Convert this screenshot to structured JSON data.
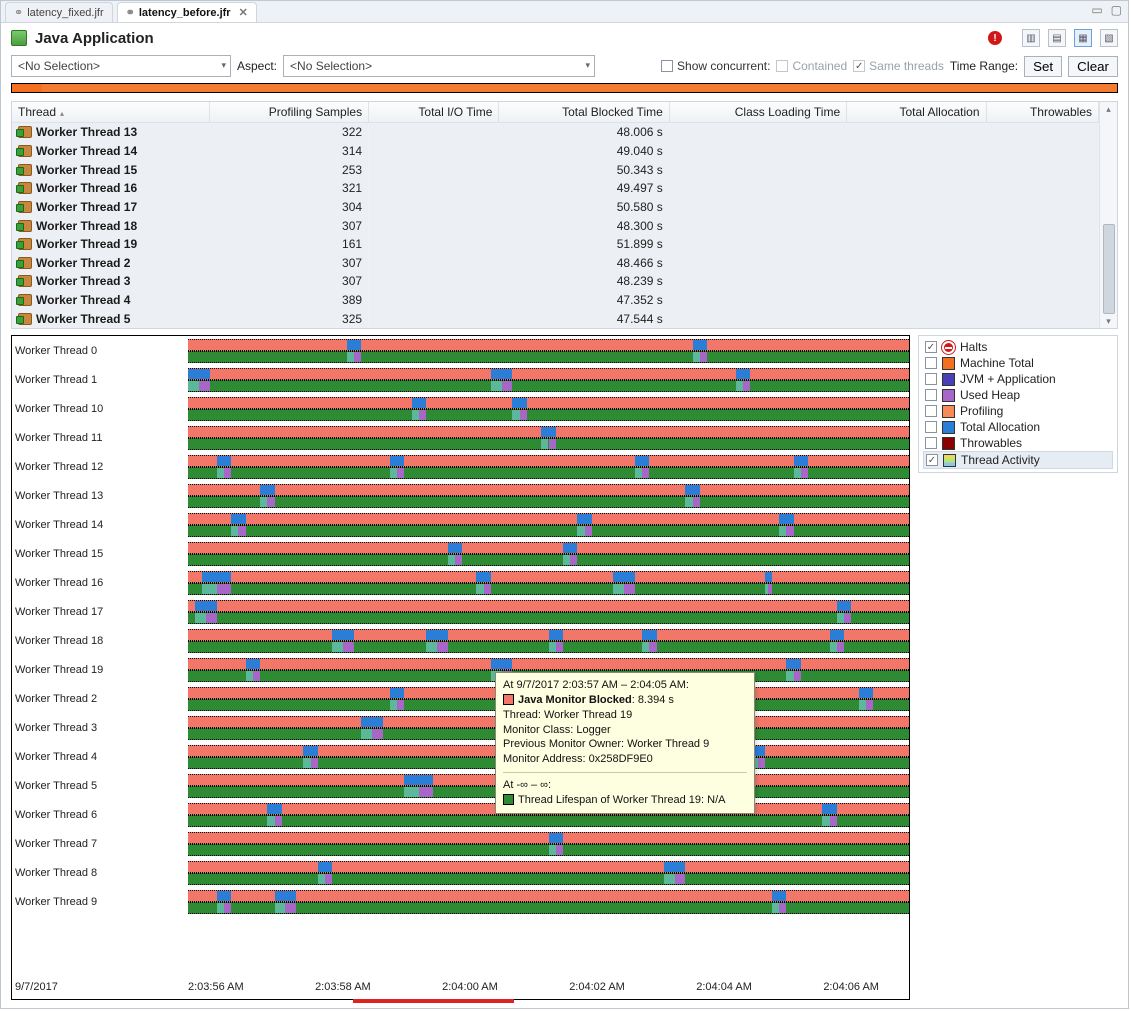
{
  "tabs": [
    {
      "label": "latency_fixed.jfr",
      "active": false
    },
    {
      "label": "latency_before.jfr",
      "active": true
    }
  ],
  "title": "Java Application",
  "header_icons": [
    "alert",
    "layout-1",
    "layout-2",
    "layout-3",
    "layout-4"
  ],
  "filters": {
    "thread_selection": "<No Selection>",
    "aspect_label": "Aspect:",
    "aspect_selection": "<No Selection>",
    "show_concurrent": "Show concurrent:",
    "contained": "Contained",
    "same_threads": "Same threads",
    "time_range_label": "Time Range:",
    "set": "Set",
    "clear": "Clear"
  },
  "columns": [
    "Thread",
    "Profiling Samples",
    "Total I/O Time",
    "Total Blocked Time",
    "Class Loading Time",
    "Total Allocation",
    "Throwables"
  ],
  "rows": [
    {
      "name": "Worker Thread 13",
      "samples": "322",
      "blocked": "48.006 s"
    },
    {
      "name": "Worker Thread 14",
      "samples": "314",
      "blocked": "49.040 s"
    },
    {
      "name": "Worker Thread 15",
      "samples": "253",
      "blocked": "50.343 s"
    },
    {
      "name": "Worker Thread 16",
      "samples": "321",
      "blocked": "49.497 s"
    },
    {
      "name": "Worker Thread 17",
      "samples": "304",
      "blocked": "50.580 s"
    },
    {
      "name": "Worker Thread 18",
      "samples": "307",
      "blocked": "48.300 s"
    },
    {
      "name": "Worker Thread 19",
      "samples": "161",
      "blocked": "51.899 s"
    },
    {
      "name": "Worker Thread 2",
      "samples": "307",
      "blocked": "48.466 s"
    },
    {
      "name": "Worker Thread 3",
      "samples": "307",
      "blocked": "48.239 s"
    },
    {
      "name": "Worker Thread 4",
      "samples": "389",
      "blocked": "47.352 s"
    },
    {
      "name": "Worker Thread 5",
      "samples": "325",
      "blocked": "47.544 s"
    }
  ],
  "lanes": [
    "Worker Thread 0",
    "Worker Thread 1",
    "Worker Thread 10",
    "Worker Thread 11",
    "Worker Thread 12",
    "Worker Thread 13",
    "Worker Thread 14",
    "Worker Thread 15",
    "Worker Thread 16",
    "Worker Thread 17",
    "Worker Thread 18",
    "Worker Thread 19",
    "Worker Thread 2",
    "Worker Thread 3",
    "Worker Thread 4",
    "Worker Thread 5",
    "Worker Thread 6",
    "Worker Thread 7",
    "Worker Thread 8",
    "Worker Thread 9"
  ],
  "lane_events": {
    "Worker Thread 0": [
      [
        22,
        2
      ],
      [
        70,
        2
      ]
    ],
    "Worker Thread 1": [
      [
        0,
        3
      ],
      [
        42,
        3
      ],
      [
        76,
        2
      ]
    ],
    "Worker Thread 10": [
      [
        31,
        2
      ],
      [
        45,
        2
      ]
    ],
    "Worker Thread 11": [
      [
        49,
        2
      ]
    ],
    "Worker Thread 12": [
      [
        4,
        2
      ],
      [
        28,
        2
      ],
      [
        62,
        2
      ],
      [
        84,
        2
      ]
    ],
    "Worker Thread 13": [
      [
        10,
        2
      ],
      [
        69,
        2
      ]
    ],
    "Worker Thread 14": [
      [
        6,
        2
      ],
      [
        54,
        2
      ],
      [
        82,
        2
      ]
    ],
    "Worker Thread 15": [
      [
        36,
        2
      ],
      [
        52,
        2
      ]
    ],
    "Worker Thread 16": [
      [
        2,
        4
      ],
      [
        40,
        2
      ],
      [
        59,
        3
      ],
      [
        80,
        1
      ]
    ],
    "Worker Thread 17": [
      [
        1,
        3
      ],
      [
        90,
        2
      ]
    ],
    "Worker Thread 18": [
      [
        20,
        3
      ],
      [
        33,
        3
      ],
      [
        50,
        2
      ],
      [
        63,
        2
      ],
      [
        89,
        2
      ]
    ],
    "Worker Thread 19": [
      [
        8,
        2
      ],
      [
        42,
        3
      ],
      [
        83,
        2
      ]
    ],
    "Worker Thread 2": [
      [
        28,
        2
      ],
      [
        58,
        2
      ],
      [
        93,
        2
      ]
    ],
    "Worker Thread 3": [
      [
        24,
        3
      ],
      [
        72,
        2
      ]
    ],
    "Worker Thread 4": [
      [
        16,
        2
      ],
      [
        56,
        2
      ],
      [
        78,
        2
      ]
    ],
    "Worker Thread 5": [
      [
        30,
        4
      ]
    ],
    "Worker Thread 6": [
      [
        11,
        2
      ],
      [
        88,
        2
      ]
    ],
    "Worker Thread 7": [
      [
        50,
        2
      ]
    ],
    "Worker Thread 8": [
      [
        18,
        2
      ],
      [
        66,
        3
      ]
    ],
    "Worker Thread 9": [
      [
        4,
        2
      ],
      [
        12,
        3
      ],
      [
        81,
        2
      ]
    ]
  },
  "axis": {
    "date": "9/7/2017",
    "ticks": [
      "2:03:56 AM",
      "2:03:58 AM",
      "2:04:00 AM",
      "2:04:02 AM",
      "2:04:04 AM",
      "2:04:06 AM"
    ]
  },
  "legend": [
    {
      "label": "Halts",
      "checked": true,
      "color": "#d01818",
      "special": "stop"
    },
    {
      "label": "Machine Total",
      "checked": false,
      "color": "#f37021"
    },
    {
      "label": "JVM + Application",
      "checked": false,
      "color": "#4a3fb5"
    },
    {
      "label": "Used Heap",
      "checked": false,
      "color": "#a866c8"
    },
    {
      "label": "Profiling",
      "checked": false,
      "color": "#f68a58"
    },
    {
      "label": "Total Allocation",
      "checked": false,
      "color": "#2b7ed8"
    },
    {
      "label": "Throwables",
      "checked": false,
      "color": "#8b0000"
    },
    {
      "label": "Thread Activity",
      "checked": true,
      "color": "#d6c551",
      "special": "stack",
      "selected": true
    }
  ],
  "tooltip": {
    "time_line": "At 9/7/2017 2:03:57 AM – 2:04:05 AM:",
    "event_color": "#f37769",
    "event_name": "Java Monitor Blocked",
    "event_duration": ": 8.394 s",
    "lines": [
      "Thread: Worker Thread 19",
      "Monitor Class: Logger",
      "Previous Monitor Owner: Worker Thread 9",
      "Monitor Address: 0x258DF9E0"
    ],
    "infinite": "At -∞ – ∞:",
    "lifespan_color": "#2e8b34",
    "lifespan": "Thread Lifespan of Worker Thread 19: N/A"
  }
}
